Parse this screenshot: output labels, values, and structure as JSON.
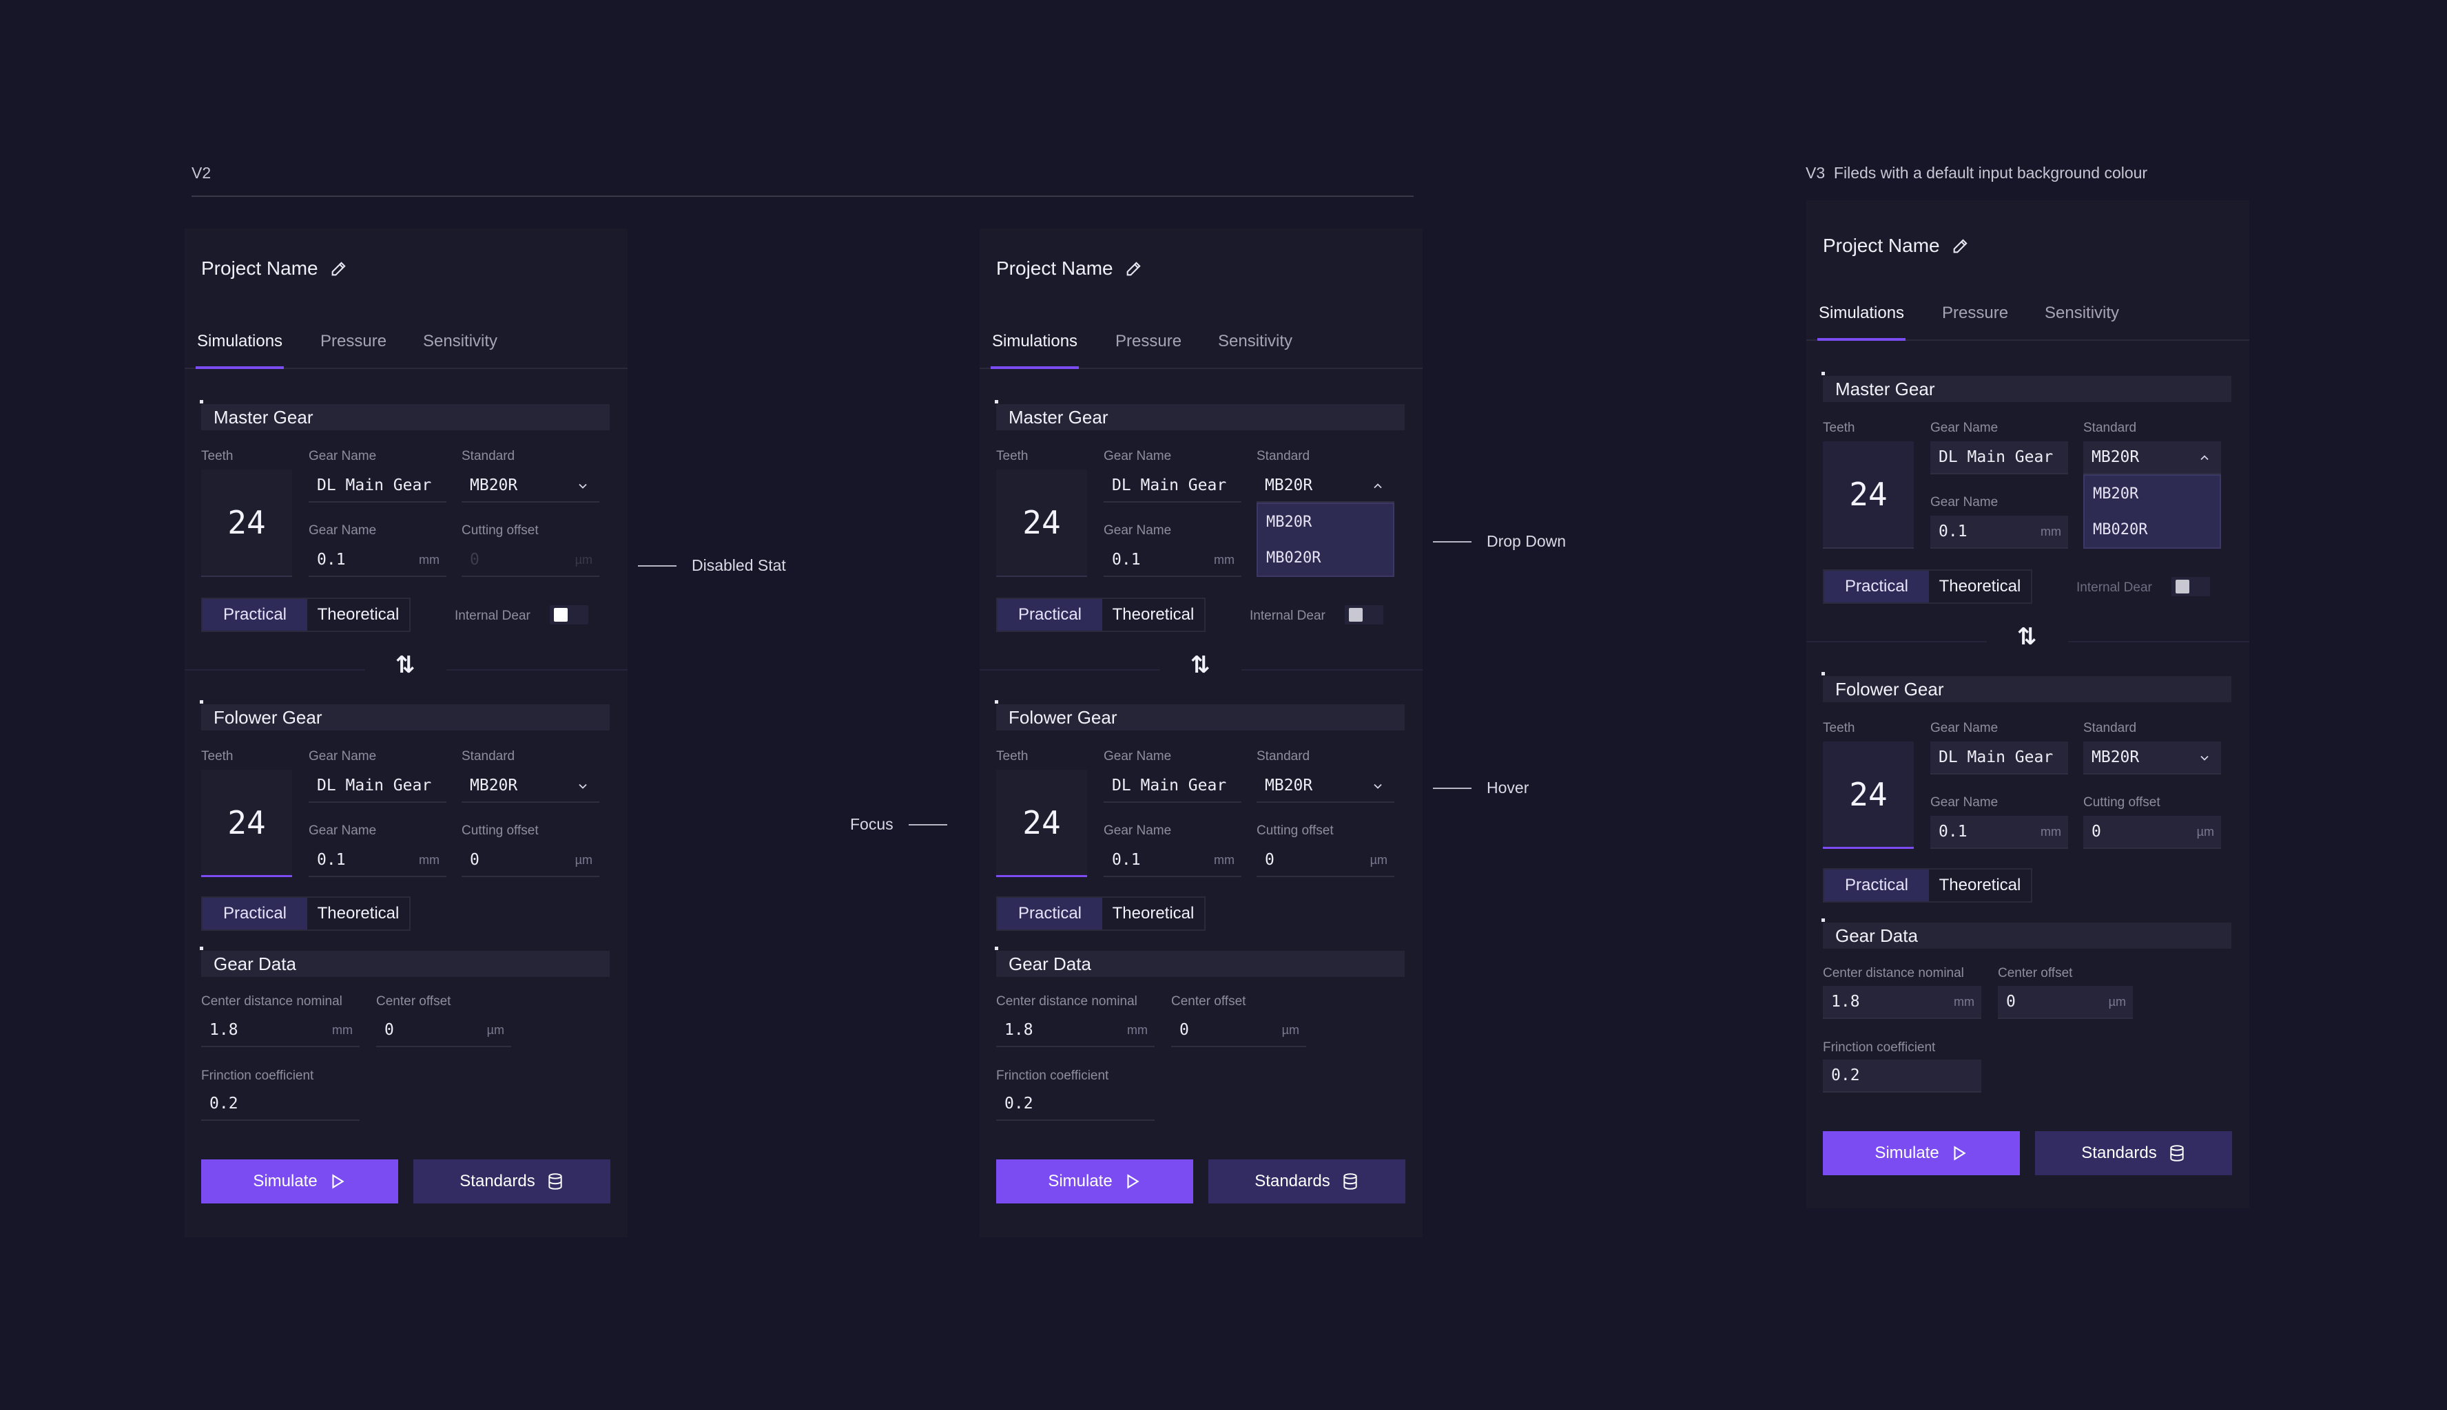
{
  "colors": {
    "background": "#171628",
    "panel": "#1b1a2a",
    "accent": "#7a4cf2",
    "segment_active": "#2f2b58",
    "dropdown": "#2e2b52"
  },
  "headers": {
    "v2_label": "V2",
    "v3_label": "V3",
    "v3_note": "Fileds with a default input background colour"
  },
  "annotations": {
    "disabled": "Disabled Stat",
    "dropdown": "Drop Down",
    "hover": "Hover",
    "focus": "Focus"
  },
  "panel": {
    "project_name": "Project Name",
    "edit_icon": "pencil-icon",
    "tabs": [
      "Simulations",
      "Pressure",
      "Sensitivity"
    ],
    "master_title": "Master Gear",
    "follower_title": "Folower Gear",
    "gear_data_title": "Gear Data",
    "labels": {
      "teeth": "Teeth",
      "gear_name": "Gear Name",
      "standard": "Standard",
      "cutting_offset": "Cutting offset",
      "center_distance": "Center distance nominal",
      "center_offset": "Center offset",
      "friction": "Frinction coefficient",
      "internal_gear": "Internal Dear"
    },
    "values": {
      "teeth": "24",
      "gear_name": "DL Main Gear",
      "standard": "MB20R",
      "module": "0.1",
      "cutting_offset": "0",
      "center_distance": "1.8",
      "center_offset": "0",
      "friction": "0.2"
    },
    "units": {
      "mm": "mm",
      "um": "µm"
    },
    "dropdown_options": [
      "MB20R",
      "MB020R"
    ],
    "segment": [
      "Practical",
      "Theoretical"
    ],
    "swap_icon": "swap-vertical-icon",
    "buttons": {
      "simulate": "Simulate",
      "standards": "Standards"
    },
    "button_icons": {
      "simulate": "play-icon",
      "standards": "database-icon"
    }
  }
}
